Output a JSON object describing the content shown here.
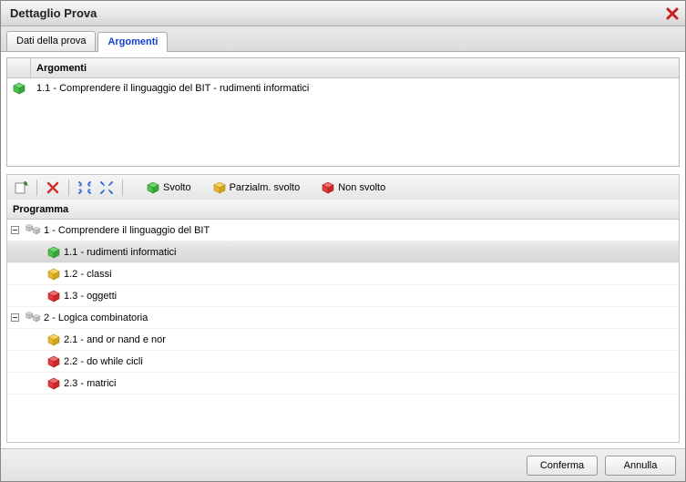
{
  "window": {
    "title": "Dettaglio Prova"
  },
  "tabs": [
    {
      "label": "Dati della prova"
    },
    {
      "label": "Argomenti"
    }
  ],
  "active_tab": 1,
  "upper_grid": {
    "header": "Argomenti",
    "rows": [
      {
        "iconColor": "#4bc24b",
        "text": "1.1 - Comprendere il linguaggio del BIT - rudimenti informatici"
      }
    ]
  },
  "legend": [
    {
      "color": "#4bc24b",
      "label": "Svolto"
    },
    {
      "color": "#e7b72b",
      "label": "Parzialm. svolto"
    },
    {
      "color": "#e23c3c",
      "label": "Non svolto"
    }
  ],
  "program": {
    "header": "Programma",
    "tree": [
      {
        "level": 0,
        "expandable": true,
        "expanded": true,
        "groupIcon": true,
        "label": "1 - Comprendere il linguaggio del BIT"
      },
      {
        "level": 1,
        "color": "#4bc24b",
        "label": "1.1 - rudimenti informatici",
        "selected": true
      },
      {
        "level": 1,
        "color": "#e7b72b",
        "label": "1.2 - classi"
      },
      {
        "level": 1,
        "color": "#e23c3c",
        "label": "1.3 - oggetti"
      },
      {
        "level": 0,
        "expandable": true,
        "expanded": true,
        "groupIcon": true,
        "label": "2 - Logica combinatoria"
      },
      {
        "level": 1,
        "color": "#e7b72b",
        "label": "2.1 - and or nand e nor"
      },
      {
        "level": 1,
        "color": "#e23c3c",
        "label": "2.2 - do while cicli"
      },
      {
        "level": 1,
        "color": "#e23c3c",
        "label": "2.3 - matrici"
      }
    ]
  },
  "footer": {
    "confirm": "Conferma",
    "cancel": "Annulla"
  }
}
